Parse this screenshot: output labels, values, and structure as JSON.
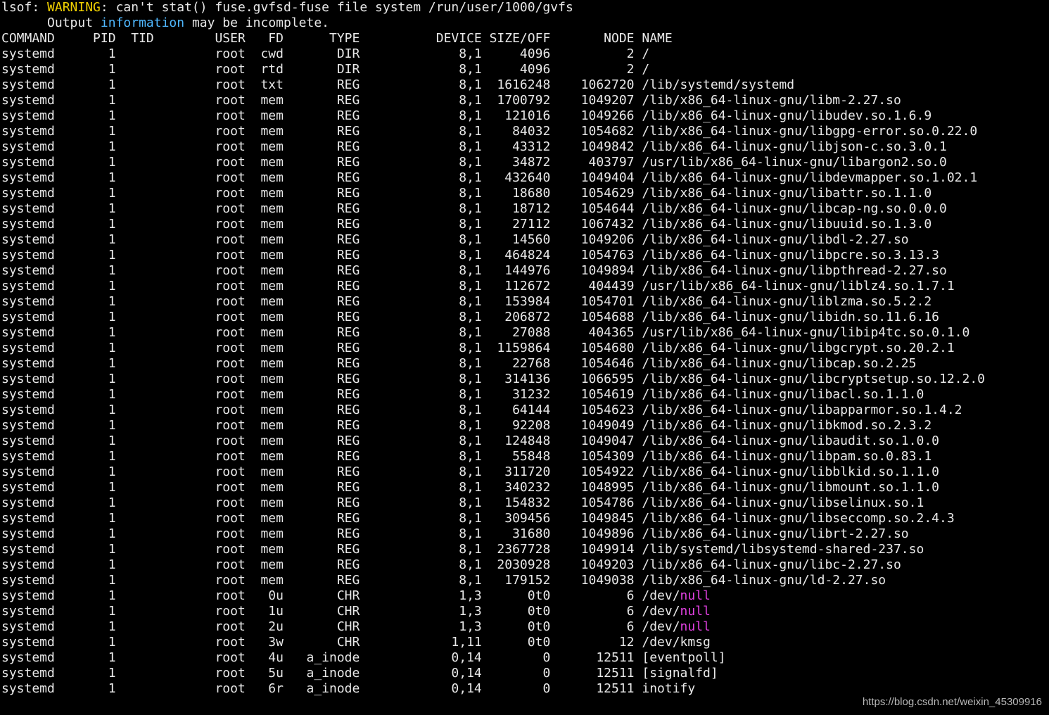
{
  "warning": {
    "prefix": "lsof: ",
    "warn_word": "WARNING",
    "rest": ": can't stat() fuse.gvfsd-fuse file system /run/user/1000/gvfs",
    "line2_indent": "      Output ",
    "info_word": "information",
    "line2_rest": " may be incomplete."
  },
  "headers": [
    "COMMAND",
    "PID",
    "TID",
    "USER",
    "FD",
    "TYPE",
    "DEVICE",
    "SIZE/OFF",
    "NODE",
    "NAME"
  ],
  "rows": [
    [
      "systemd",
      "1",
      "",
      "root",
      "cwd",
      "DIR",
      "8,1",
      "4096",
      "2",
      "/"
    ],
    [
      "systemd",
      "1",
      "",
      "root",
      "rtd",
      "DIR",
      "8,1",
      "4096",
      "2",
      "/"
    ],
    [
      "systemd",
      "1",
      "",
      "root",
      "txt",
      "REG",
      "8,1",
      "1616248",
      "1062720",
      "/lib/systemd/systemd"
    ],
    [
      "systemd",
      "1",
      "",
      "root",
      "mem",
      "REG",
      "8,1",
      "1700792",
      "1049207",
      "/lib/x86_64-linux-gnu/libm-2.27.so"
    ],
    [
      "systemd",
      "1",
      "",
      "root",
      "mem",
      "REG",
      "8,1",
      "121016",
      "1049266",
      "/lib/x86_64-linux-gnu/libudev.so.1.6.9"
    ],
    [
      "systemd",
      "1",
      "",
      "root",
      "mem",
      "REG",
      "8,1",
      "84032",
      "1054682",
      "/lib/x86_64-linux-gnu/libgpg-error.so.0.22.0"
    ],
    [
      "systemd",
      "1",
      "",
      "root",
      "mem",
      "REG",
      "8,1",
      "43312",
      "1049842",
      "/lib/x86_64-linux-gnu/libjson-c.so.3.0.1"
    ],
    [
      "systemd",
      "1",
      "",
      "root",
      "mem",
      "REG",
      "8,1",
      "34872",
      "403797",
      "/usr/lib/x86_64-linux-gnu/libargon2.so.0"
    ],
    [
      "systemd",
      "1",
      "",
      "root",
      "mem",
      "REG",
      "8,1",
      "432640",
      "1049404",
      "/lib/x86_64-linux-gnu/libdevmapper.so.1.02.1"
    ],
    [
      "systemd",
      "1",
      "",
      "root",
      "mem",
      "REG",
      "8,1",
      "18680",
      "1054629",
      "/lib/x86_64-linux-gnu/libattr.so.1.1.0"
    ],
    [
      "systemd",
      "1",
      "",
      "root",
      "mem",
      "REG",
      "8,1",
      "18712",
      "1054644",
      "/lib/x86_64-linux-gnu/libcap-ng.so.0.0.0"
    ],
    [
      "systemd",
      "1",
      "",
      "root",
      "mem",
      "REG",
      "8,1",
      "27112",
      "1067432",
      "/lib/x86_64-linux-gnu/libuuid.so.1.3.0"
    ],
    [
      "systemd",
      "1",
      "",
      "root",
      "mem",
      "REG",
      "8,1",
      "14560",
      "1049206",
      "/lib/x86_64-linux-gnu/libdl-2.27.so"
    ],
    [
      "systemd",
      "1",
      "",
      "root",
      "mem",
      "REG",
      "8,1",
      "464824",
      "1054763",
      "/lib/x86_64-linux-gnu/libpcre.so.3.13.3"
    ],
    [
      "systemd",
      "1",
      "",
      "root",
      "mem",
      "REG",
      "8,1",
      "144976",
      "1049894",
      "/lib/x86_64-linux-gnu/libpthread-2.27.so"
    ],
    [
      "systemd",
      "1",
      "",
      "root",
      "mem",
      "REG",
      "8,1",
      "112672",
      "404439",
      "/usr/lib/x86_64-linux-gnu/liblz4.so.1.7.1"
    ],
    [
      "systemd",
      "1",
      "",
      "root",
      "mem",
      "REG",
      "8,1",
      "153984",
      "1054701",
      "/lib/x86_64-linux-gnu/liblzma.so.5.2.2"
    ],
    [
      "systemd",
      "1",
      "",
      "root",
      "mem",
      "REG",
      "8,1",
      "206872",
      "1054688",
      "/lib/x86_64-linux-gnu/libidn.so.11.6.16"
    ],
    [
      "systemd",
      "1",
      "",
      "root",
      "mem",
      "REG",
      "8,1",
      "27088",
      "404365",
      "/usr/lib/x86_64-linux-gnu/libip4tc.so.0.1.0"
    ],
    [
      "systemd",
      "1",
      "",
      "root",
      "mem",
      "REG",
      "8,1",
      "1159864",
      "1054680",
      "/lib/x86_64-linux-gnu/libgcrypt.so.20.2.1"
    ],
    [
      "systemd",
      "1",
      "",
      "root",
      "mem",
      "REG",
      "8,1",
      "22768",
      "1054646",
      "/lib/x86_64-linux-gnu/libcap.so.2.25"
    ],
    [
      "systemd",
      "1",
      "",
      "root",
      "mem",
      "REG",
      "8,1",
      "314136",
      "1066595",
      "/lib/x86_64-linux-gnu/libcryptsetup.so.12.2.0"
    ],
    [
      "systemd",
      "1",
      "",
      "root",
      "mem",
      "REG",
      "8,1",
      "31232",
      "1054619",
      "/lib/x86_64-linux-gnu/libacl.so.1.1.0"
    ],
    [
      "systemd",
      "1",
      "",
      "root",
      "mem",
      "REG",
      "8,1",
      "64144",
      "1054623",
      "/lib/x86_64-linux-gnu/libapparmor.so.1.4.2"
    ],
    [
      "systemd",
      "1",
      "",
      "root",
      "mem",
      "REG",
      "8,1",
      "92208",
      "1049049",
      "/lib/x86_64-linux-gnu/libkmod.so.2.3.2"
    ],
    [
      "systemd",
      "1",
      "",
      "root",
      "mem",
      "REG",
      "8,1",
      "124848",
      "1049047",
      "/lib/x86_64-linux-gnu/libaudit.so.1.0.0"
    ],
    [
      "systemd",
      "1",
      "",
      "root",
      "mem",
      "REG",
      "8,1",
      "55848",
      "1054309",
      "/lib/x86_64-linux-gnu/libpam.so.0.83.1"
    ],
    [
      "systemd",
      "1",
      "",
      "root",
      "mem",
      "REG",
      "8,1",
      "311720",
      "1054922",
      "/lib/x86_64-linux-gnu/libblkid.so.1.1.0"
    ],
    [
      "systemd",
      "1",
      "",
      "root",
      "mem",
      "REG",
      "8,1",
      "340232",
      "1048995",
      "/lib/x86_64-linux-gnu/libmount.so.1.1.0"
    ],
    [
      "systemd",
      "1",
      "",
      "root",
      "mem",
      "REG",
      "8,1",
      "154832",
      "1054786",
      "/lib/x86_64-linux-gnu/libselinux.so.1"
    ],
    [
      "systemd",
      "1",
      "",
      "root",
      "mem",
      "REG",
      "8,1",
      "309456",
      "1049845",
      "/lib/x86_64-linux-gnu/libseccomp.so.2.4.3"
    ],
    [
      "systemd",
      "1",
      "",
      "root",
      "mem",
      "REG",
      "8,1",
      "31680",
      "1049896",
      "/lib/x86_64-linux-gnu/librt-2.27.so"
    ],
    [
      "systemd",
      "1",
      "",
      "root",
      "mem",
      "REG",
      "8,1",
      "2367728",
      "1049914",
      "/lib/systemd/libsystemd-shared-237.so"
    ],
    [
      "systemd",
      "1",
      "",
      "root",
      "mem",
      "REG",
      "8,1",
      "2030928",
      "1049203",
      "/lib/x86_64-linux-gnu/libc-2.27.so"
    ],
    [
      "systemd",
      "1",
      "",
      "root",
      "mem",
      "REG",
      "8,1",
      "179152",
      "1049038",
      "/lib/x86_64-linux-gnu/ld-2.27.so"
    ],
    [
      "systemd",
      "1",
      "",
      "root",
      "0u",
      "CHR",
      "1,3",
      "0t0",
      "6",
      "/dev/null"
    ],
    [
      "systemd",
      "1",
      "",
      "root",
      "1u",
      "CHR",
      "1,3",
      "0t0",
      "6",
      "/dev/null"
    ],
    [
      "systemd",
      "1",
      "",
      "root",
      "2u",
      "CHR",
      "1,3",
      "0t0",
      "6",
      "/dev/null"
    ],
    [
      "systemd",
      "1",
      "",
      "root",
      "3w",
      "CHR",
      "1,11",
      "0t0",
      "12",
      "/dev/kmsg"
    ],
    [
      "systemd",
      "1",
      "",
      "root",
      "4u",
      "a_inode",
      "0,14",
      "0",
      "12511",
      "[eventpoll]"
    ],
    [
      "systemd",
      "1",
      "",
      "root",
      "5u",
      "a_inode",
      "0,14",
      "0",
      "12511",
      "[signalfd]"
    ],
    [
      "systemd",
      "1",
      "",
      "root",
      "6r",
      "a_inode",
      "0,14",
      "0",
      "12511",
      "inotify"
    ]
  ],
  "watermark": "https://blog.csdn.net/weixin_45309916",
  "colors": {
    "background": "#000000",
    "text": "#e8e8e8",
    "warning": "#f0d000",
    "info": "#4fb8ff",
    "null_highlight": "#e040e0"
  }
}
